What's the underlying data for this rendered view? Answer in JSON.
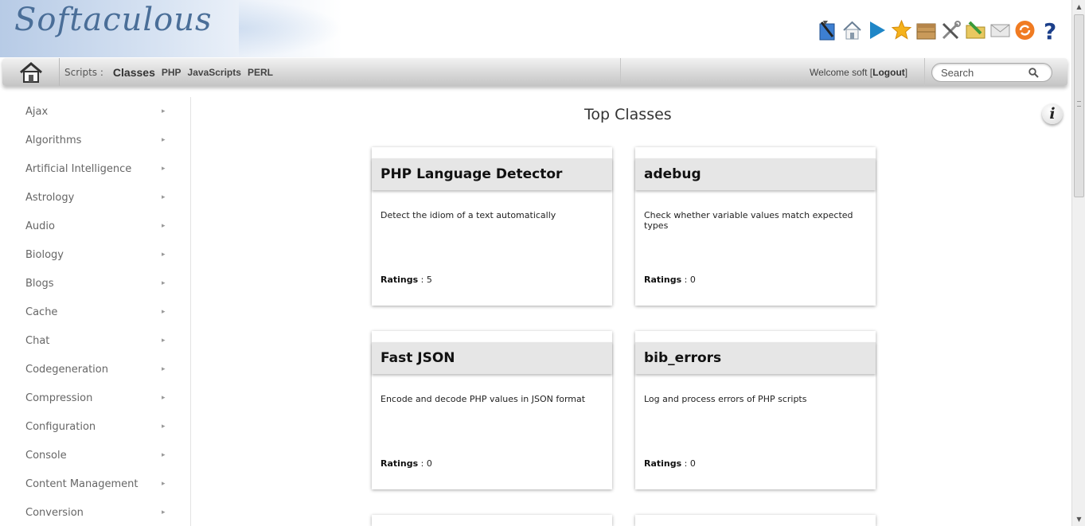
{
  "header": {
    "logo_text": "Softaculous",
    "toolbar_icons": [
      "install-tool-icon",
      "home-icon",
      "play-icon",
      "star-icon",
      "box-icon",
      "tools-icon",
      "folder-edit-icon",
      "mail-icon",
      "refresh-icon",
      "help-icon"
    ]
  },
  "nav": {
    "scripts_label": "Scripts :",
    "active": "Classes",
    "links": [
      "PHP",
      "JavaScripts",
      "PERL"
    ],
    "welcome_prefix": "Welcome soft [",
    "logout_label": "Logout",
    "welcome_suffix": "]",
    "search_placeholder": "Search"
  },
  "sidebar": {
    "items": [
      {
        "label": "Ajax"
      },
      {
        "label": "Algorithms"
      },
      {
        "label": "Artificial Intelligence"
      },
      {
        "label": "Astrology"
      },
      {
        "label": "Audio"
      },
      {
        "label": "Biology"
      },
      {
        "label": "Blogs"
      },
      {
        "label": "Cache"
      },
      {
        "label": "Chat"
      },
      {
        "label": "Codegeneration"
      },
      {
        "label": "Compression"
      },
      {
        "label": "Configuration"
      },
      {
        "label": "Console"
      },
      {
        "label": "Content Management"
      },
      {
        "label": "Conversion"
      }
    ]
  },
  "main": {
    "title": "Top Classes",
    "ratings_label": "Ratings",
    "cards": [
      {
        "title": "PHP Language Detector",
        "description": "Detect the idiom of a text automatically",
        "rating": "5"
      },
      {
        "title": "adebug",
        "description": "Check whether variable values match expected types",
        "rating": "0"
      },
      {
        "title": "Fast JSON",
        "description": "Encode and decode PHP values in JSON format",
        "rating": "0"
      },
      {
        "title": "bib_errors",
        "description": "Log and process errors of PHP scripts",
        "rating": "0"
      }
    ]
  },
  "colors": {
    "logo": "#4a6e98",
    "navbar_top": "#f2f2f2",
    "navbar_bottom": "#c4c4c4",
    "card_header": "#e6e6e6"
  }
}
